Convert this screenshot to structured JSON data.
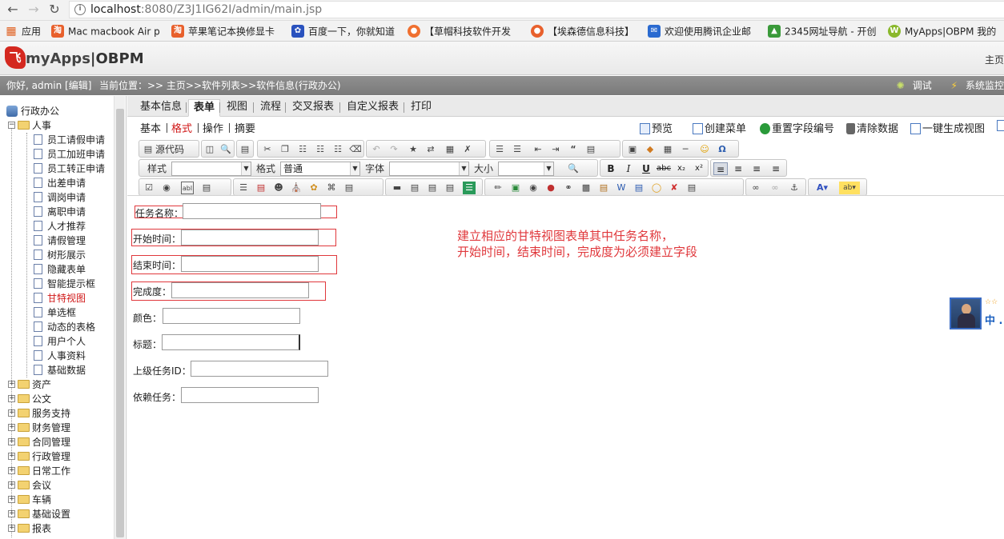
{
  "browser": {
    "url_host": "localhost",
    "url_path": ":8080/Z3J1IG62I/admin/main.jsp",
    "bookmarks": [
      {
        "label": "应用",
        "icon": "apps-grid-icon",
        "color": "#e06020"
      },
      {
        "label": "Mac macbook Air p",
        "icon": "taobao-icon",
        "color": "#e8602c"
      },
      {
        "label": "苹果笔记本换修显卡",
        "icon": "taobao-icon",
        "color": "#e8602c"
      },
      {
        "label": "百度一下，你就知道",
        "icon": "baidu-paw-icon",
        "color": "#2a52be"
      },
      {
        "label": "【草帽科技软件开发",
        "icon": "site-icon",
        "color": "#f07030"
      },
      {
        "label": "【埃森德信息科技】",
        "icon": "site-icon",
        "color": "#e8602c"
      },
      {
        "label": "欢迎使用腾讯企业邮",
        "icon": "mail-icon",
        "color": "#2a6ad0"
      },
      {
        "label": "2345网址导航 - 开创",
        "icon": "2345-icon",
        "color": "#3a9a3a"
      },
      {
        "label": "MyApps|OBPM 我的",
        "icon": "myapps-icon",
        "color": "#8ab82c"
      }
    ]
  },
  "header": {
    "logo_mark": "飞",
    "logo_prefix": "myApps",
    "logo_suffix": "|OBPM",
    "right_link": "主页"
  },
  "status": {
    "welcome": "你好, admin [编辑]",
    "breadcrumb": "当前位置：>> 主页>>软件列表>>软件信息(行政办公)",
    "debug": "调试",
    "monitor": "系统监控"
  },
  "sidebar": {
    "root": "行政办公",
    "hr_folder": "人事",
    "hr_items": [
      "员工请假申请",
      "员工加班申请",
      "员工转正申请",
      "出差申请",
      "调岗申请",
      "离职申请",
      "人才推荐",
      "请假管理",
      "树形展示",
      "隐藏表单",
      "智能提示框",
      "甘特视图",
      "单选框",
      "动态的表格",
      "用户个人",
      "人事资料",
      "基础数据"
    ],
    "active_item": "甘特视图",
    "folders": [
      "资产",
      "公文",
      "服务支持",
      "财务管理",
      "合同管理",
      "行政管理",
      "日常工作",
      "会议",
      "车辆",
      "基础设置",
      "报表"
    ]
  },
  "tabs": [
    "基本信息",
    "表单",
    "视图",
    "流程",
    "交叉报表",
    "自定义报表",
    "打印"
  ],
  "selected_tab": "表单",
  "subtabs": [
    "基本",
    "格式",
    "操作",
    "摘要"
  ],
  "selected_subtab": "格式",
  "actions": {
    "preview": "预览",
    "create_menu": "创建菜单",
    "reset_field_no": "重置字段编号",
    "clear_data": "清除数据",
    "generate_view": "一键生成视图"
  },
  "toolbar": {
    "source": "源代码",
    "style_label": "样式",
    "style_value": "",
    "format_label": "格式",
    "format_value": "普通",
    "font_label": "字体",
    "font_value": "",
    "size_label": "大小",
    "size_value": ""
  },
  "form": {
    "fields": [
      "任务名称：",
      "开始时间：",
      "结束时间：",
      "完成度：",
      "颜色：",
      "标题：",
      "上级任务ID：",
      "依赖任务："
    ]
  },
  "annotation": {
    "line1": "建立相应的甘特视图表单其中任务名称，",
    "line2": "开始时间，结束时间，完成度为必须建立字段"
  },
  "widget": {
    "stars": "☆☆",
    "text": "中 ."
  }
}
